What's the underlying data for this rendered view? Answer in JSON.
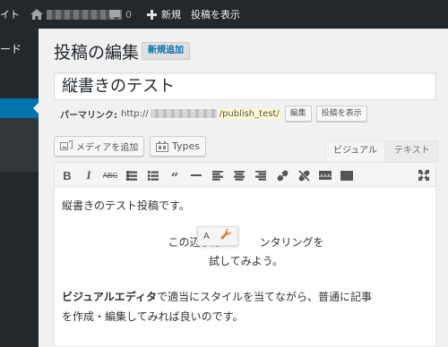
{
  "adminbar": {
    "site_label": "イト",
    "comment_count": "0",
    "new_label": "新規",
    "view_post": "投稿を表示"
  },
  "sidebar": {
    "dashboard_label": "ード"
  },
  "page": {
    "title": "投稿の編集",
    "add_new": "新規追加"
  },
  "post": {
    "title_value": "縦書きのテスト",
    "permalink_label": "パーマリンク:",
    "permalink_prefix": "http://",
    "permalink_slug": "/publish_test/",
    "edit_button": "編集",
    "view_button": "投稿を表示"
  },
  "media": {
    "add_media": "メディアを追加",
    "types": "Types"
  },
  "editor": {
    "tab_visual": "ビジュアル",
    "tab_text": "テキスト",
    "p1": "縦書きのテスト投稿です。",
    "p2_line1": "この辺りは",
    "p2_line1_end": "ンタリングを",
    "p2_line2": "試してみよう。",
    "p3_bold": "ビジュアルエディタ",
    "p3_rest": "で適当にスタイルを当てながら、普通に記事",
    "p3_line2": "を作成・編集してみれば良いのです。",
    "float_a": "A"
  },
  "colors": {
    "adminbar_bg": "#23282d",
    "accent": "#0073aa",
    "slug_highlight": "#fffbcc"
  }
}
